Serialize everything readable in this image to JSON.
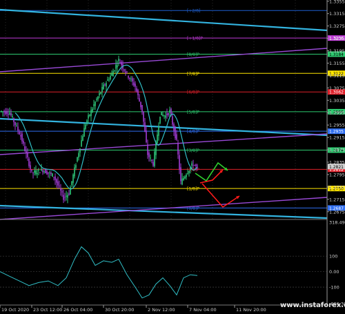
{
  "watermark": "www.instaforex.com",
  "colors": {
    "background": "#000000",
    "bull": "#2ec77a",
    "bear": "#a23cd6",
    "trend": "#33b4e0",
    "channel": "#9a4ad8",
    "ma": "#31c0c8",
    "arrow_up": "#2fd12f",
    "arrow_red": "#ff1a1a"
  },
  "chart_data": {
    "type": "candlestick",
    "instrument_axis": "price",
    "ylim": [
      1.265,
      1.335
    ],
    "y_ticks": [
      "1.3355",
      "1.3315",
      "1.3275",
      "1.3235",
      "1.3195",
      "1.3155",
      "1.3115",
      "1.3075",
      "1.3035",
      "1.2995",
      "1.2955",
      "1.2915",
      "1.2875",
      "1.2835",
      "1.2795",
      "1.2755",
      "1.2715",
      "1.2675"
    ],
    "x_ticks": [
      "19 Oct 2020",
      "23 Oct 12:00",
      "26 Oct 04:00",
      "30 Oct 20:00",
      "2 Nov 12:00",
      "7 Nov 04:00",
      "11 Nov 20:00",
      "14 Nov 04:00"
    ],
    "murray_levels": [
      {
        "label": "[+2/8]",
        "price": 1.3325,
        "color": "#1e5fd0",
        "tag": ""
      },
      {
        "label": "[+1/8]P",
        "price": 1.3236,
        "color": "#c03ad8",
        "tag": "1.3236"
      },
      {
        "label": "[8/8]P",
        "price": 1.3184,
        "color": "#2ecc71",
        "tag": "1.3184"
      },
      {
        "label": "[7/8]P",
        "price": 1.3122,
        "color": "#ffe600",
        "tag": "1.3122"
      },
      {
        "label": "[6/8]P",
        "price": 1.3062,
        "color": "#e0202a",
        "tag": "1.3062"
      },
      {
        "label": "[5/8]P",
        "price": 1.2998,
        "color": "#2ecc71",
        "tag": "1.2998"
      },
      {
        "label": "[4/8]P",
        "price": 1.2935,
        "color": "#2f6ef0",
        "tag": "1.2935"
      },
      {
        "label": "[3/8]P",
        "price": 1.2874,
        "color": "#2ecc71",
        "tag": "1.2874"
      },
      {
        "label": "[2/8]P",
        "price": 1.2812,
        "color": "#e0202a",
        "tag": "1.2812"
      },
      {
        "label": "[1/8]P",
        "price": 1.275,
        "color": "#ffe600",
        "tag": "1.2750"
      },
      {
        "label": "[0/8]P",
        "price": 1.2687,
        "color": "#2f6ef0",
        "tag": "1.2687"
      }
    ],
    "current_price": {
      "value": 1.2821,
      "tag": "1.2821"
    },
    "osc_ticks": [
      "318.4908",
      "100",
      "0.00",
      "-100",
      "-206.3015"
    ]
  }
}
